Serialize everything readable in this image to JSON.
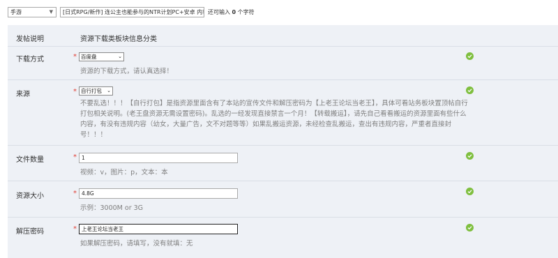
{
  "topbar": {
    "category": "手游",
    "title_value": "[日式RPG/新作] 连公主也能参与的NTR计划PC+安卓 内容",
    "remaining_prefix": "还可输入",
    "remaining_count": "0",
    "remaining_suffix": "个字符"
  },
  "header": {
    "label": "发帖说明",
    "description": "资源下载类板块信息分类"
  },
  "fields": {
    "download": {
      "label": "下载方式",
      "required": "*",
      "value": "百度盘",
      "hint": "资源的下载方式，请认真选择！"
    },
    "source": {
      "label": "来源",
      "required": "*",
      "value": "自行打包",
      "hint": "不要乱选！！！【自行打包】是指资源里面含有了本站的宣传文件和解压密码为【上老王论坛当老王】，具体可看站务板块置顶帖自行打包相关说明。(老王盘资源无需设置密码)。乱选的一经发现直接禁言一个月！【转载搬运】，请先自己看看搬运的资源里面有些什么内容，有没有违规内容（幼女，大量广告，文不对题等等）如果乱搬运资源，未经检查乱搬运，查出有违规内容，严重者直接封号！！！"
    },
    "file_count": {
      "label": "文件数量",
      "required": "*",
      "value": "1",
      "hint": "视频：v，图片：p，文本：本"
    },
    "size": {
      "label": "资源大小",
      "required": "*",
      "value": "4.8G",
      "hint": "示例：3000M or 3G"
    },
    "password": {
      "label": "解压密码",
      "required": "*",
      "value": "上老王论坛当老王",
      "hint": "如果解压密码，请填写，没有就填：无"
    }
  },
  "colors": {
    "panel_bg": "#eef1f6",
    "required": "#e03c31",
    "ok_icon": "#7fbf3f",
    "hint": "#7f7f7f"
  }
}
